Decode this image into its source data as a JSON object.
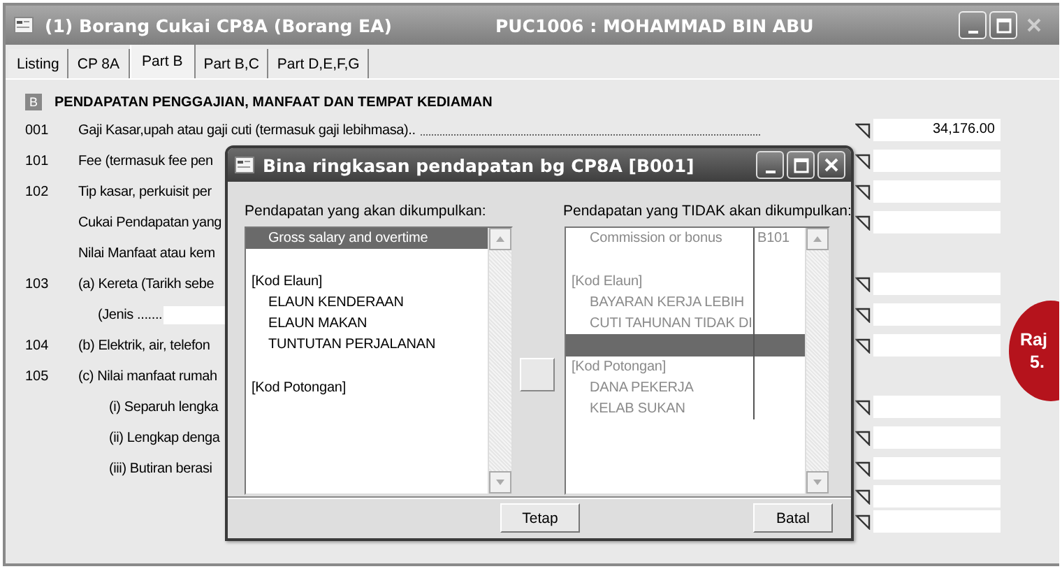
{
  "window": {
    "title": "(1)  Borang Cukai CP8A (Borang EA)",
    "subtitle": "PUC1006 : MOHAMMAD BIN ABU",
    "close_disabled": true
  },
  "tabs": [
    {
      "label": "Listing",
      "selected": false
    },
    {
      "label": "CP 8A",
      "selected": false
    },
    {
      "label": "Part B",
      "selected": true
    },
    {
      "label": "Part B,C",
      "selected": false
    },
    {
      "label": "Part D,E,F,G",
      "selected": false
    }
  ],
  "section": {
    "letter": "B",
    "title": "PENDAPATAN PENGGAJIAN, MANFAAT DAN TEMPAT KEDIAMAN"
  },
  "rows": [
    {
      "kind": "main",
      "code": "001",
      "label": "Gaji Kasar,upah atau gaji cuti (termasuk gaji lebihmasa)..",
      "leader": true,
      "field": {
        "value": "34,176.00"
      }
    },
    {
      "kind": "main",
      "code": "101",
      "label": "Fee (termasuk fee pen",
      "field": {}
    },
    {
      "kind": "main",
      "code": "102",
      "label": "Tip kasar, perkuisit per",
      "field": {}
    },
    {
      "kind": "main",
      "label": "Cukai Pendapatan yang",
      "field": {}
    },
    {
      "kind": "main",
      "label": "Nilai Manfaat atau kem"
    },
    {
      "kind": "main",
      "code": "103",
      "label": "(a) Kereta (Tarikh sebe",
      "field": {}
    },
    {
      "kind": "jenis",
      "label": "(Jenis .......",
      "field": {}
    },
    {
      "kind": "main",
      "code": "104",
      "label": "(b) Elektrik, air, telefon",
      "field": {}
    },
    {
      "kind": "main",
      "code": "105",
      "label": "(c) Nilai manfaat rumah"
    },
    {
      "kind": "sub",
      "label": "(i) Separuh lengka",
      "field": {}
    },
    {
      "kind": "sub",
      "label": "(ii) Lengkap denga",
      "field": {}
    },
    {
      "kind": "sub",
      "label": "(iii) Butiran berasi",
      "field": {}
    },
    {
      "kind": "blank",
      "field": {}
    },
    {
      "kind": "blank",
      "field": {}
    }
  ],
  "dialog": {
    "title": "Bina ringkasan pendapatan bg CP8A [B001]",
    "left": {
      "label": "Pendapatan yang akan dikumpulkan:",
      "greyed": false,
      "items": [
        {
          "kind": "item",
          "text": "Gross salary and overtime",
          "selected": true
        },
        {
          "kind": "blank",
          "selected": false
        },
        {
          "kind": "header",
          "text": "[Kod Elaun]",
          "selected": false
        },
        {
          "kind": "item",
          "text": "ELAUN KENDERAAN",
          "selected": false
        },
        {
          "kind": "item",
          "text": "ELAUN MAKAN",
          "selected": false
        },
        {
          "kind": "item",
          "text": "TUNTUTAN PERJALANAN",
          "selected": false
        },
        {
          "kind": "blank",
          "selected": false
        },
        {
          "kind": "header",
          "text": "[Kod Potongan]",
          "selected": false
        }
      ]
    },
    "right": {
      "label": "Pendapatan yang TIDAK akan dikumpulkan:",
      "greyed": true,
      "items": [
        {
          "kind": "item",
          "text": "Commission or bonus",
          "code": "B101",
          "selected": false
        },
        {
          "kind": "blank",
          "selected": false
        },
        {
          "kind": "header",
          "text": "[Kod Elaun]",
          "selected": false
        },
        {
          "kind": "item",
          "text": "BAYARAN KERJA LEBIH",
          "selected": false
        },
        {
          "kind": "item",
          "text": "CUTI TAHUNAN TIDAK DI",
          "selected": false
        },
        {
          "kind": "blank",
          "selected": true
        },
        {
          "kind": "header",
          "text": "[Kod Potongan]",
          "selected": false
        },
        {
          "kind": "item",
          "text": "DANA PEKERJA",
          "selected": false
        },
        {
          "kind": "item",
          "text": "KELAB SUKAN",
          "selected": false
        }
      ]
    },
    "buttons": [
      "Tetap",
      "Batal"
    ]
  },
  "badge": {
    "lines": [
      "Raj",
      "5."
    ]
  }
}
